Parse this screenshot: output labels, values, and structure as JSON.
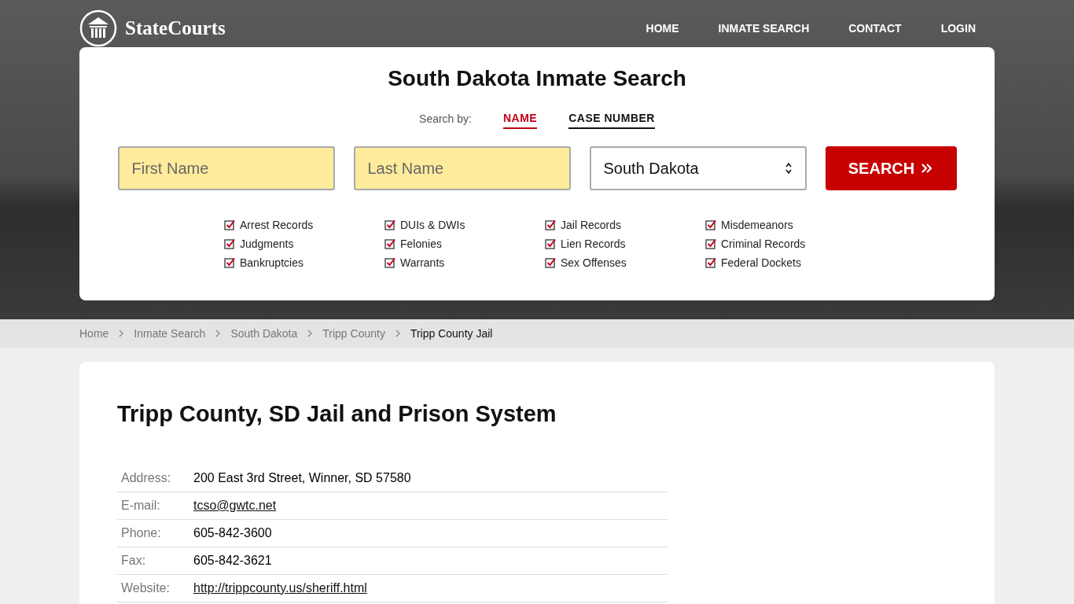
{
  "header": {
    "logo": "StateCourts",
    "nav": [
      {
        "label": "HOME"
      },
      {
        "label": "INMATE SEARCH"
      },
      {
        "label": "CONTACT"
      },
      {
        "label": "LOGIN"
      }
    ]
  },
  "search": {
    "title": "South Dakota Inmate Search",
    "search_by_label": "Search by:",
    "tabs": [
      {
        "label": "NAME",
        "selected": true
      },
      {
        "label": "CASE NUMBER",
        "selected": false
      }
    ],
    "first_name": {
      "placeholder": "First Name"
    },
    "last_name": {
      "placeholder": "Last Name"
    },
    "state": {
      "value": "South Dakota"
    },
    "button": "SEARCH",
    "record_types": [
      {
        "label": "Arrest Records",
        "checked": true
      },
      {
        "label": "Judgments",
        "checked": true
      },
      {
        "label": "Bankruptcies",
        "checked": true
      },
      {
        "label": "DUIs & DWIs",
        "checked": true
      },
      {
        "label": "Felonies",
        "checked": true
      },
      {
        "label": "Warrants",
        "checked": true
      },
      {
        "label": "Jail Records",
        "checked": true
      },
      {
        "label": "Lien Records",
        "checked": true
      },
      {
        "label": "Sex Offenses",
        "checked": true
      },
      {
        "label": "Misdemeanors",
        "checked": true
      },
      {
        "label": "Criminal Records",
        "checked": true
      },
      {
        "label": "Federal Dockets",
        "checked": true
      }
    ]
  },
  "breadcrumb": [
    {
      "label": "Home",
      "current": false
    },
    {
      "label": "Inmate Search",
      "current": false
    },
    {
      "label": "South Dakota",
      "current": false
    },
    {
      "label": "Tripp County",
      "current": false
    },
    {
      "label": "Tripp County Jail",
      "current": true
    }
  ],
  "content": {
    "title": "Tripp County, SD Jail and Prison System",
    "details": [
      {
        "label": "Address:",
        "value": "200 East 3rd Street, Winner, SD 57580",
        "kind": "text"
      },
      {
        "label": "E-mail:",
        "value": "tcso@gwtc.net",
        "kind": "link"
      },
      {
        "label": "Phone:",
        "value": "605-842-3600",
        "kind": "text"
      },
      {
        "label": "Fax:",
        "value": "605-842-3621",
        "kind": "text"
      },
      {
        "label": "Website:",
        "value": "http://trippcounty.us/sheriff.html",
        "kind": "link"
      }
    ]
  }
}
